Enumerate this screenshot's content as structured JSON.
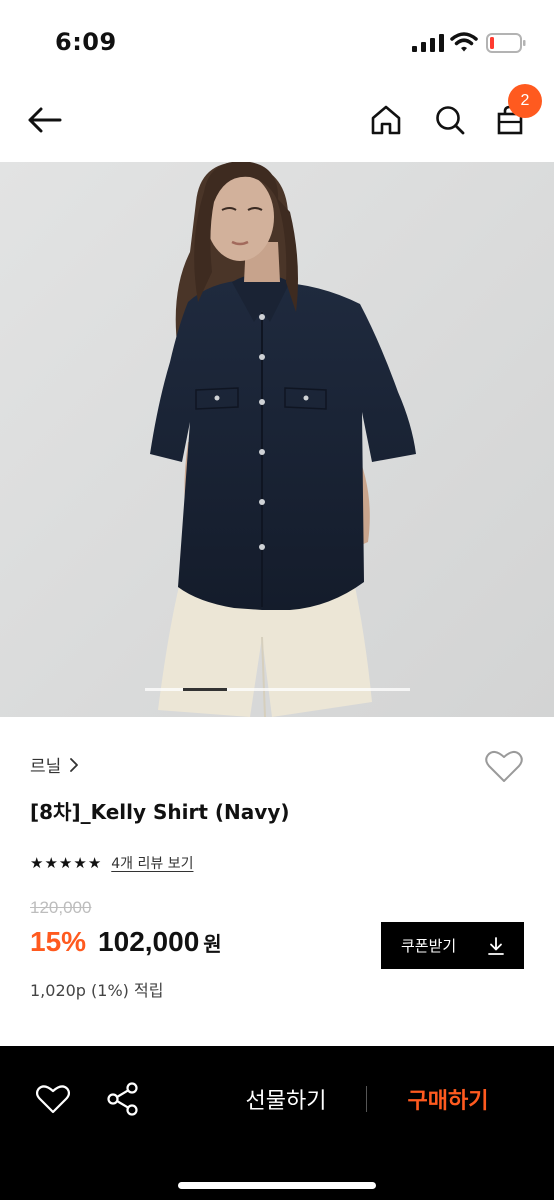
{
  "status_bar": {
    "time": "6:09",
    "battery_color": "#ff3b30"
  },
  "nav": {
    "icons": [
      "back-arrow-icon",
      "home-icon",
      "search-icon",
      "shopping-bag-icon"
    ],
    "cart_count": "2",
    "accent": "#ff5a1f"
  },
  "hero": {
    "image": "model wearing navy short-sleeve shirt and cream shorts",
    "carousel_progress": 0.17
  },
  "product": {
    "brand": "르닐",
    "title": "[8차]_Kelly Shirt (Navy)",
    "rating": 5,
    "review_link": "4개 리뷰 보기",
    "original_price": "120,000",
    "discount": "15%",
    "sale_price": "102,000",
    "currency": "원",
    "points": "1,020p (1%) 적립",
    "coupon_button": "쿠폰받기"
  },
  "bottom_bar": {
    "gift_label": "선물하기",
    "buy_label": "구매하기",
    "buy_color": "#ff5a1f"
  }
}
